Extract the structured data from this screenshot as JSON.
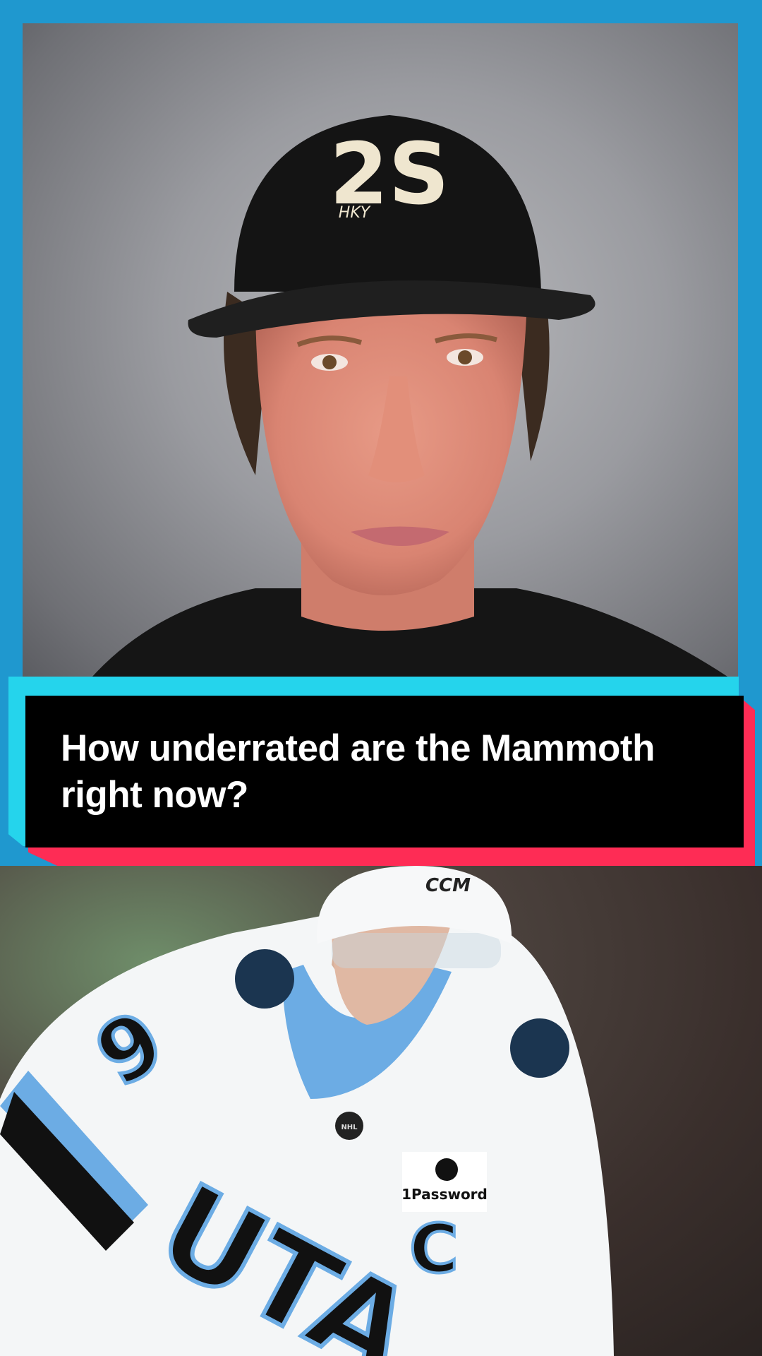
{
  "caption": {
    "text": "How underrated are the Mammoth right now?"
  },
  "webcam": {
    "cap_logo": "2S",
    "cap_sublogo": "HKY"
  },
  "player": {
    "helmet_brand": "CCM",
    "jersey_number": "9",
    "jersey_text": "UTA",
    "captain_letter": "C",
    "sponsor_patch": "1Password",
    "league_logo": "NHL"
  },
  "colors": {
    "background": "#1f98cf",
    "caption_cyan": "#25d4ec",
    "caption_red": "#fe2c55",
    "caption_box": "#000000",
    "jersey_blue": "#6cace4"
  }
}
